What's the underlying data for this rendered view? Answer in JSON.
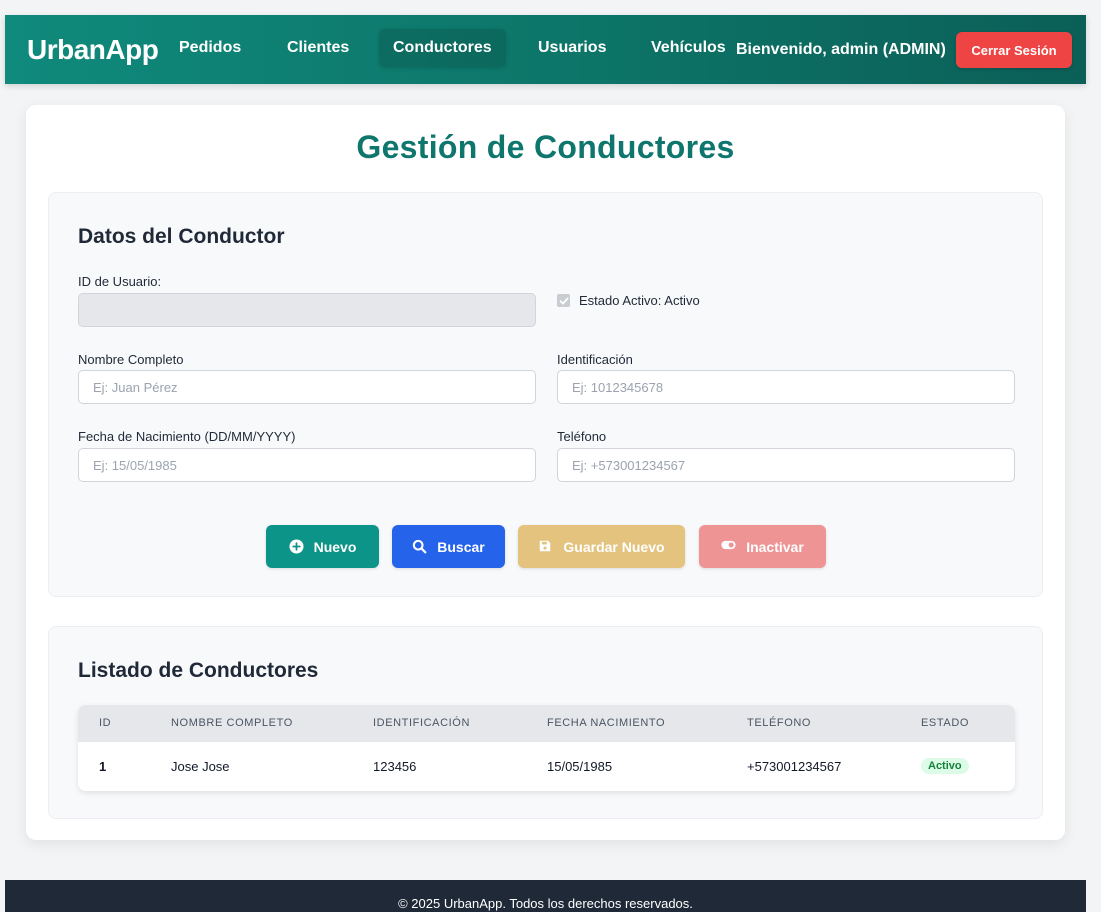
{
  "navbar": {
    "brand": "UrbanApp",
    "links": [
      {
        "label": "Pedidos",
        "active": false
      },
      {
        "label": "Clientes",
        "active": false
      },
      {
        "label": "Conductores",
        "active": true
      },
      {
        "label": "Usuarios",
        "active": false
      },
      {
        "label": "Vehículos",
        "active": false
      }
    ],
    "welcome": "Bienvenido, admin (ADMIN)",
    "logout_label": "Cerrar Sesión",
    "gradient_colors": [
      "#0f8a7c",
      "#0b5f57"
    ]
  },
  "page": {
    "title": "Gestión de Conductores",
    "title_color": "#0f766e"
  },
  "form": {
    "title": "Datos del Conductor",
    "user_id": {
      "label": "ID de Usuario:",
      "value": "",
      "disabled": true
    },
    "active": {
      "label": "Estado Activo: Activo",
      "checked": true,
      "disabled": true
    },
    "full_name": {
      "label": "Nombre Completo",
      "placeholder": "Ej: Juan Pérez",
      "value": ""
    },
    "identification": {
      "label": "Identificación",
      "placeholder": "Ej: 1012345678",
      "value": ""
    },
    "birth_date": {
      "label": "Fecha de Nacimiento (DD/MM/YYYY)",
      "placeholder": "Ej: 15/05/1985",
      "value": ""
    },
    "phone": {
      "label": "Teléfono",
      "placeholder": "Ej: +573001234567",
      "value": ""
    },
    "buttons": {
      "new": {
        "label": "Nuevo",
        "icon": "plus-circle-icon",
        "color": "#0d9488"
      },
      "search": {
        "label": "Buscar",
        "icon": "search-icon",
        "color": "#2563eb"
      },
      "save": {
        "label": "Guardar Nuevo",
        "icon": "save-icon",
        "color": "#e3c37e"
      },
      "deactivate": {
        "label": "Inactivar",
        "icon": "toggle-icon",
        "color": "#ee9494"
      }
    }
  },
  "list": {
    "title": "Listado de Conductores",
    "columns": [
      "ID",
      "NOMBRE COMPLETO",
      "IDENTIFICACIÓN",
      "FECHA NACIMIENTO",
      "TELÉFONO",
      "ESTADO"
    ],
    "rows": [
      {
        "id": "1",
        "name": "Jose Jose",
        "identification": "123456",
        "birth_date": "15/05/1985",
        "phone": "+573001234567",
        "status": "Activo"
      }
    ],
    "status_colors": {
      "active_bg": "#dcfce7",
      "active_text": "#15803d"
    }
  },
  "footer": {
    "text": "© 2025 UrbanApp. Todos los derechos reservados."
  }
}
